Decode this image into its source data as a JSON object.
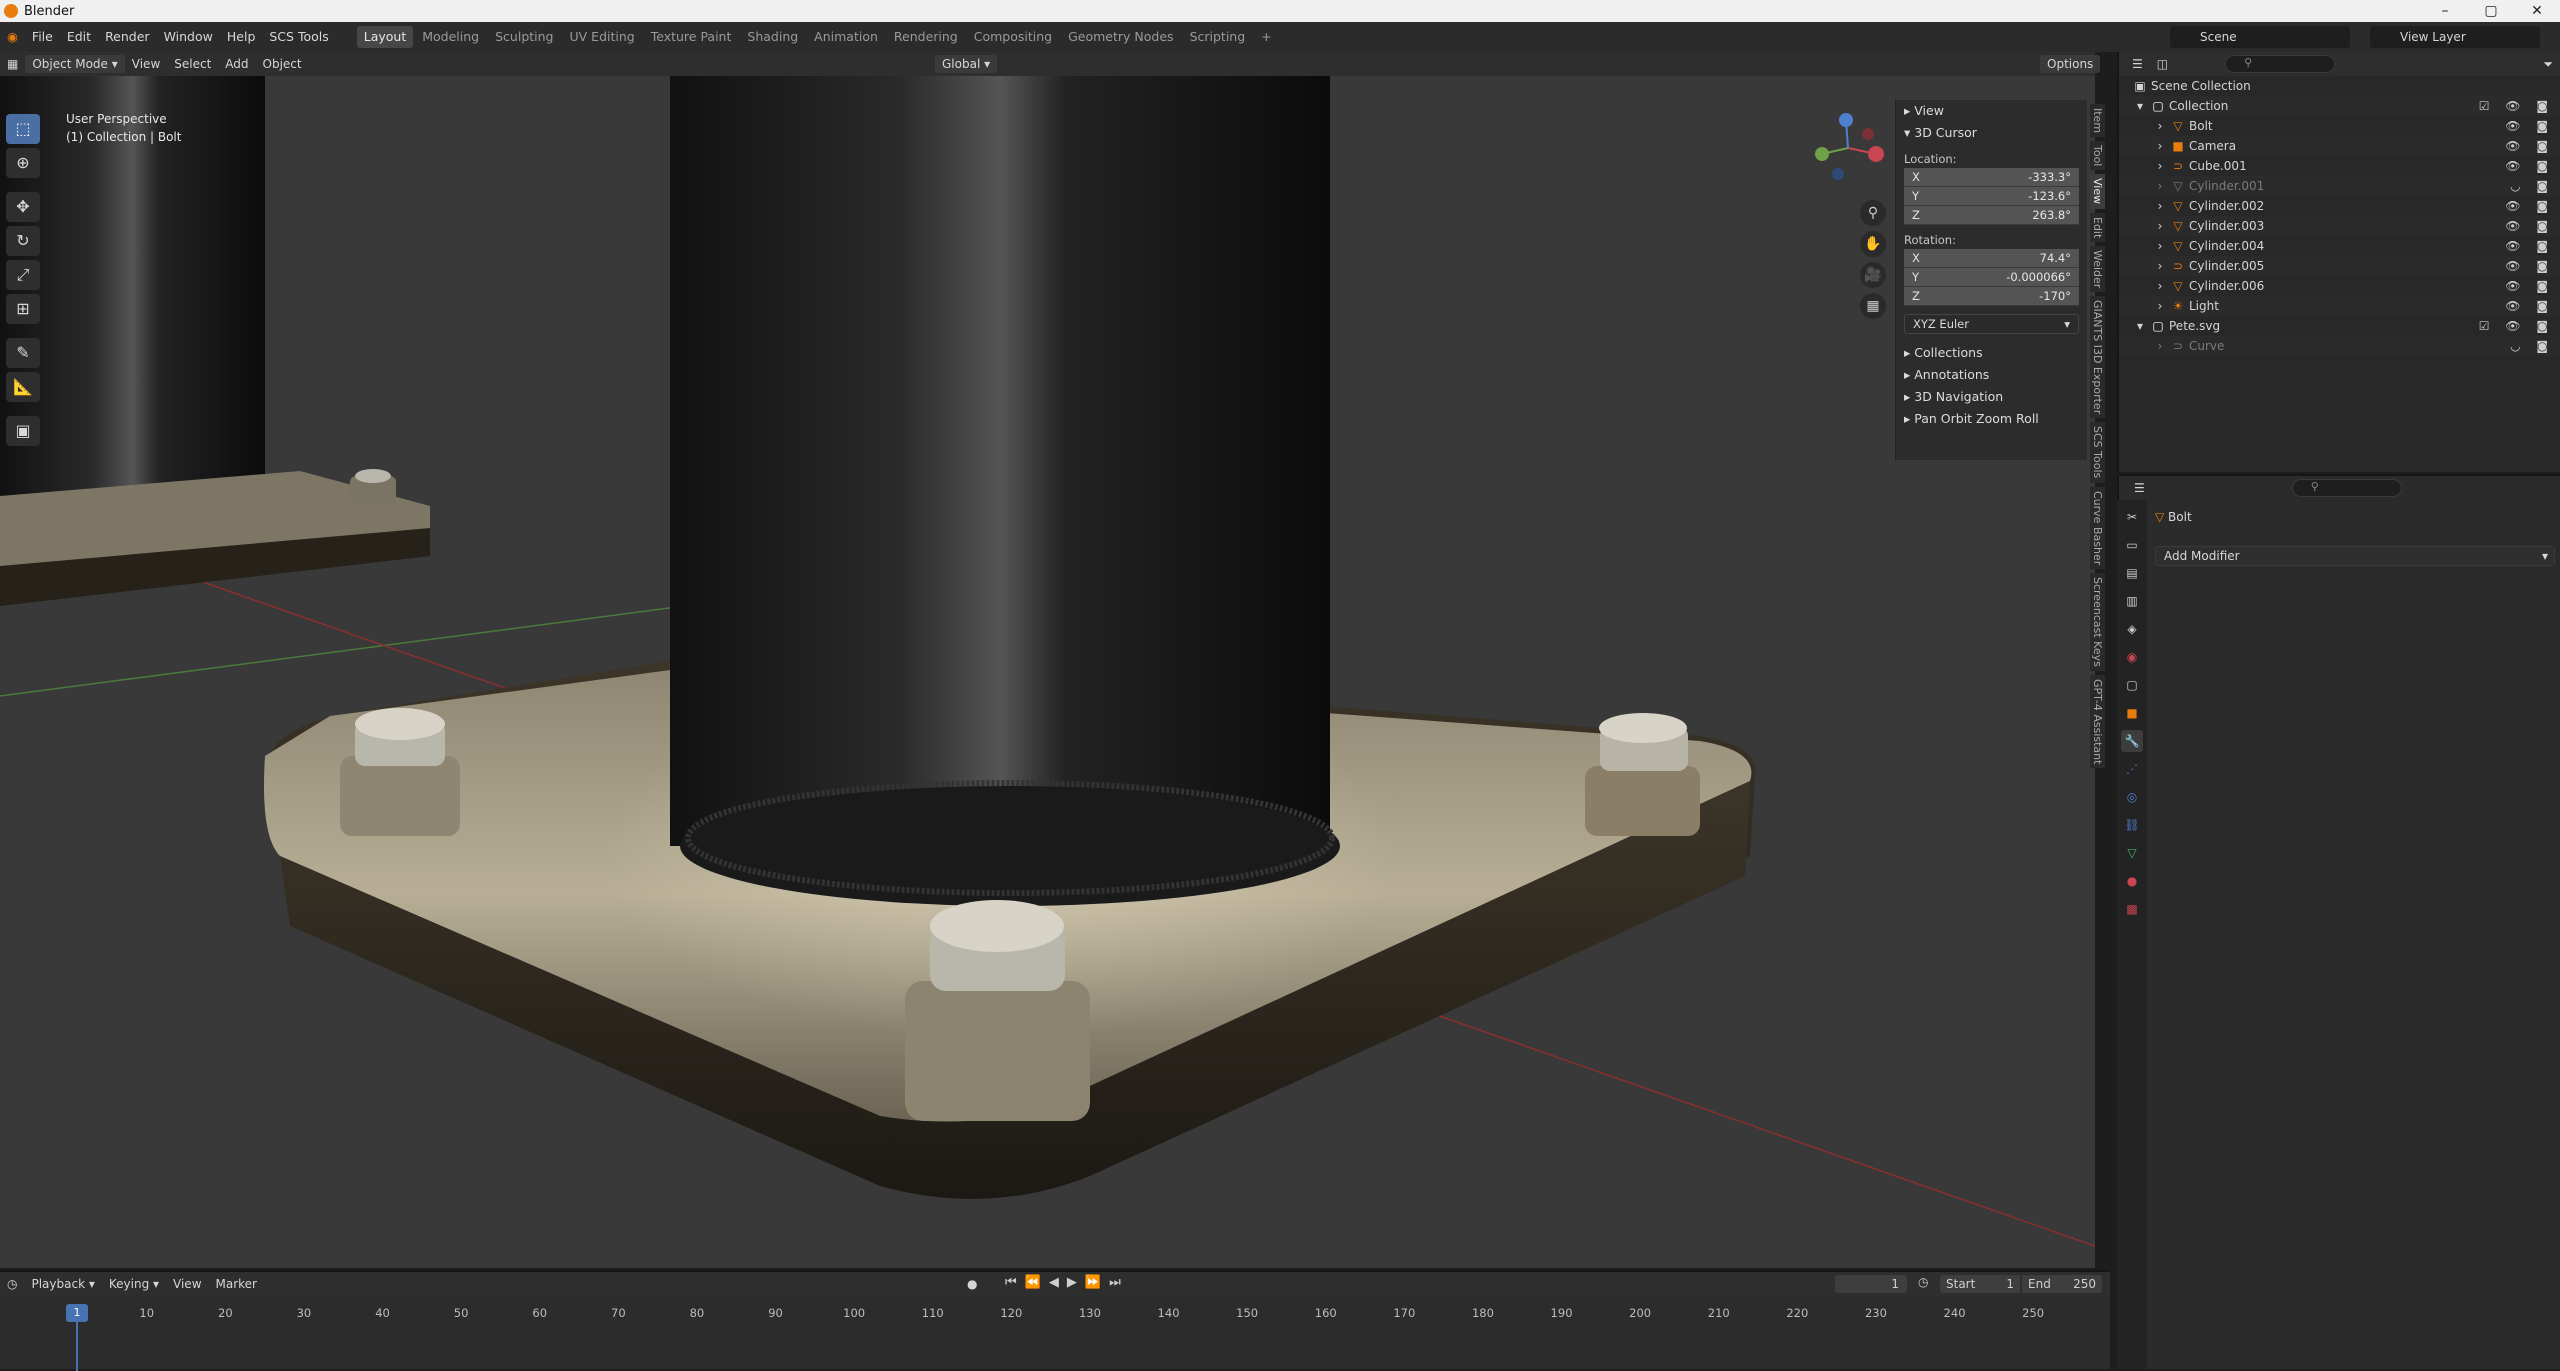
{
  "titlebar": {
    "title": "Blender"
  },
  "menus": [
    "File",
    "Edit",
    "Render",
    "Window",
    "Help",
    "SCS Tools"
  ],
  "workspaces": [
    "Layout",
    "Modeling",
    "Sculpting",
    "UV Editing",
    "Texture Paint",
    "Shading",
    "Animation",
    "Rendering",
    "Compositing",
    "Geometry Nodes",
    "Scripting"
  ],
  "active_workspace": "Layout",
  "top_right": {
    "scene": "Scene",
    "view_layer": "View Layer"
  },
  "viewport_header": {
    "mode": "Object Mode",
    "menus": [
      "View",
      "Select",
      "Add",
      "Object"
    ],
    "orientation": "Global",
    "options": "Options"
  },
  "viewport_overlay": {
    "perspective": "User Perspective",
    "context": "(1) Collection | Bolt"
  },
  "npanel": {
    "view": "View",
    "cursor": "3D Cursor",
    "location_label": "Location:",
    "location": [
      {
        "axis": "X",
        "value": "-333.3°"
      },
      {
        "axis": "Y",
        "value": "-123.6°"
      },
      {
        "axis": "Z",
        "value": "263.8°"
      }
    ],
    "rotation_label": "Rotation:",
    "rotation": [
      {
        "axis": "X",
        "value": "74.4°"
      },
      {
        "axis": "Y",
        "value": "-0.000066°"
      },
      {
        "axis": "Z",
        "value": "-170°"
      }
    ],
    "euler": "XYZ Euler",
    "sections": [
      "Collections",
      "Annotations",
      "3D Navigation",
      "Pan Orbit Zoom Roll"
    ],
    "tabs": [
      "Item",
      "Tool",
      "View",
      "Edit",
      "Weider",
      "GIANTS I3D Exporter",
      "SCS Tools",
      "Curve Basher",
      "Screencast Keys",
      "GPT-4 Assistant"
    ]
  },
  "outliner": {
    "root": "Scene Collection",
    "collection": "Collection",
    "items": [
      {
        "name": "Bolt",
        "icon": "mesh-icon",
        "dim": false
      },
      {
        "name": "Camera",
        "icon": "camera-icon",
        "dim": false
      },
      {
        "name": "Cube.001",
        "icon": "curve-icon",
        "dim": false
      },
      {
        "name": "Cylinder.001",
        "icon": "mesh-icon",
        "dim": true
      },
      {
        "name": "Cylinder.002",
        "icon": "mesh-icon",
        "dim": false
      },
      {
        "name": "Cylinder.003",
        "icon": "mesh-icon",
        "dim": false
      },
      {
        "name": "Cylinder.004",
        "icon": "mesh-icon",
        "dim": false
      },
      {
        "name": "Cylinder.005",
        "icon": "curve-icon",
        "dim": false
      },
      {
        "name": "Cylinder.006",
        "icon": "mesh-icon",
        "dim": false
      },
      {
        "name": "Light",
        "icon": "light-icon",
        "dim": false
      }
    ],
    "collection2": "Pete.svg",
    "collection2_items": [
      {
        "name": "Curve",
        "icon": "curve-icon",
        "dim": true
      }
    ]
  },
  "properties": {
    "object": "Bolt",
    "add_modifier": "Add Modifier"
  },
  "timeline": {
    "menus": [
      "Playback",
      "Keying",
      "View",
      "Marker"
    ],
    "current_frame": "1",
    "start_label": "Start",
    "start": "1",
    "end_label": "End",
    "end": "250",
    "ticks": [
      "1",
      "10",
      "20",
      "30",
      "40",
      "50",
      "60",
      "70",
      "80",
      "90",
      "100",
      "110",
      "120",
      "130",
      "140",
      "150",
      "160",
      "170",
      "180",
      "190",
      "200",
      "210",
      "220",
      "230",
      "240",
      "250"
    ]
  },
  "colors": {
    "accent": "#4772b3",
    "orange": "#e87d0d",
    "mesh": "#3fb36b"
  }
}
